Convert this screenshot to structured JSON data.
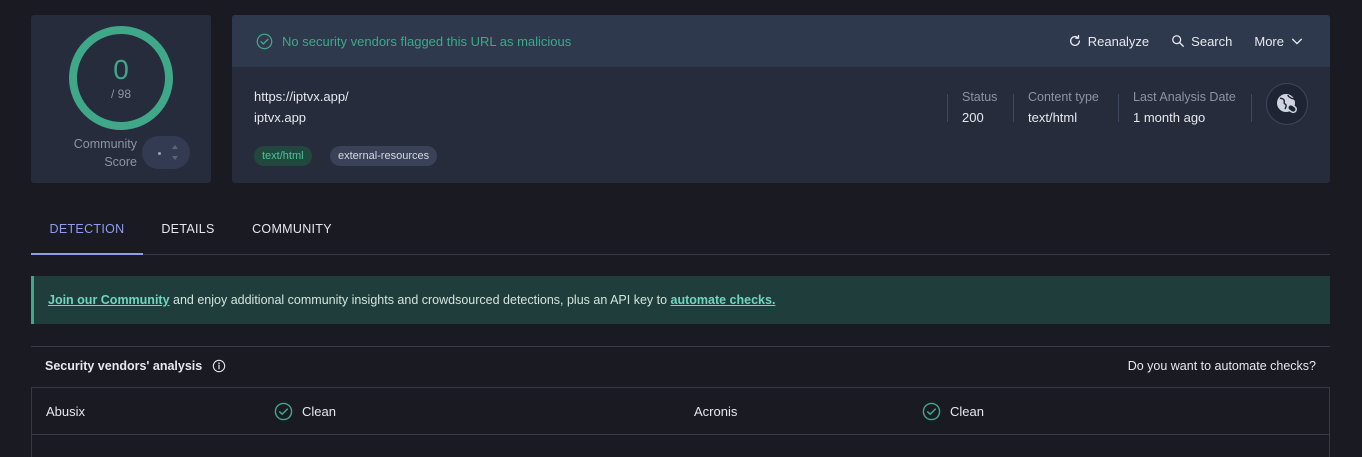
{
  "score": {
    "detections": "0",
    "total": "/ 98",
    "community_label": "Community\nScore"
  },
  "banner": {
    "message": "No security vendors flagged this URL as malicious",
    "actions": {
      "reanalyze": "Reanalyze",
      "search": "Search",
      "more": "More"
    }
  },
  "summary": {
    "url": "https://iptvx.app/",
    "domain": "iptvx.app",
    "tags": [
      "text/html",
      "external-resources"
    ],
    "meta": [
      {
        "key": "Status",
        "value": "200"
      },
      {
        "key": "Content type",
        "value": "text/html"
      },
      {
        "key": "Last Analysis Date",
        "value": "1 month ago"
      }
    ]
  },
  "tabs": [
    "DETECTION",
    "DETAILS",
    "COMMUNITY"
  ],
  "community_banner": {
    "link1": "Join our Community",
    "middle": " and enjoy additional community insights and crowdsourced detections, plus an API key to ",
    "link2": "automate checks."
  },
  "vendors": {
    "title": "Security vendors' analysis",
    "automate": "Do you want to automate checks?",
    "rows": [
      {
        "left_name": "Abusix",
        "left_result": "Clean",
        "right_name": "Acronis",
        "right_result": "Clean"
      }
    ]
  },
  "colors": {
    "accent_green": "#3fa888",
    "tab_active": "#8f9cf0",
    "background": "#1a1a22",
    "card": "#262c3b"
  }
}
